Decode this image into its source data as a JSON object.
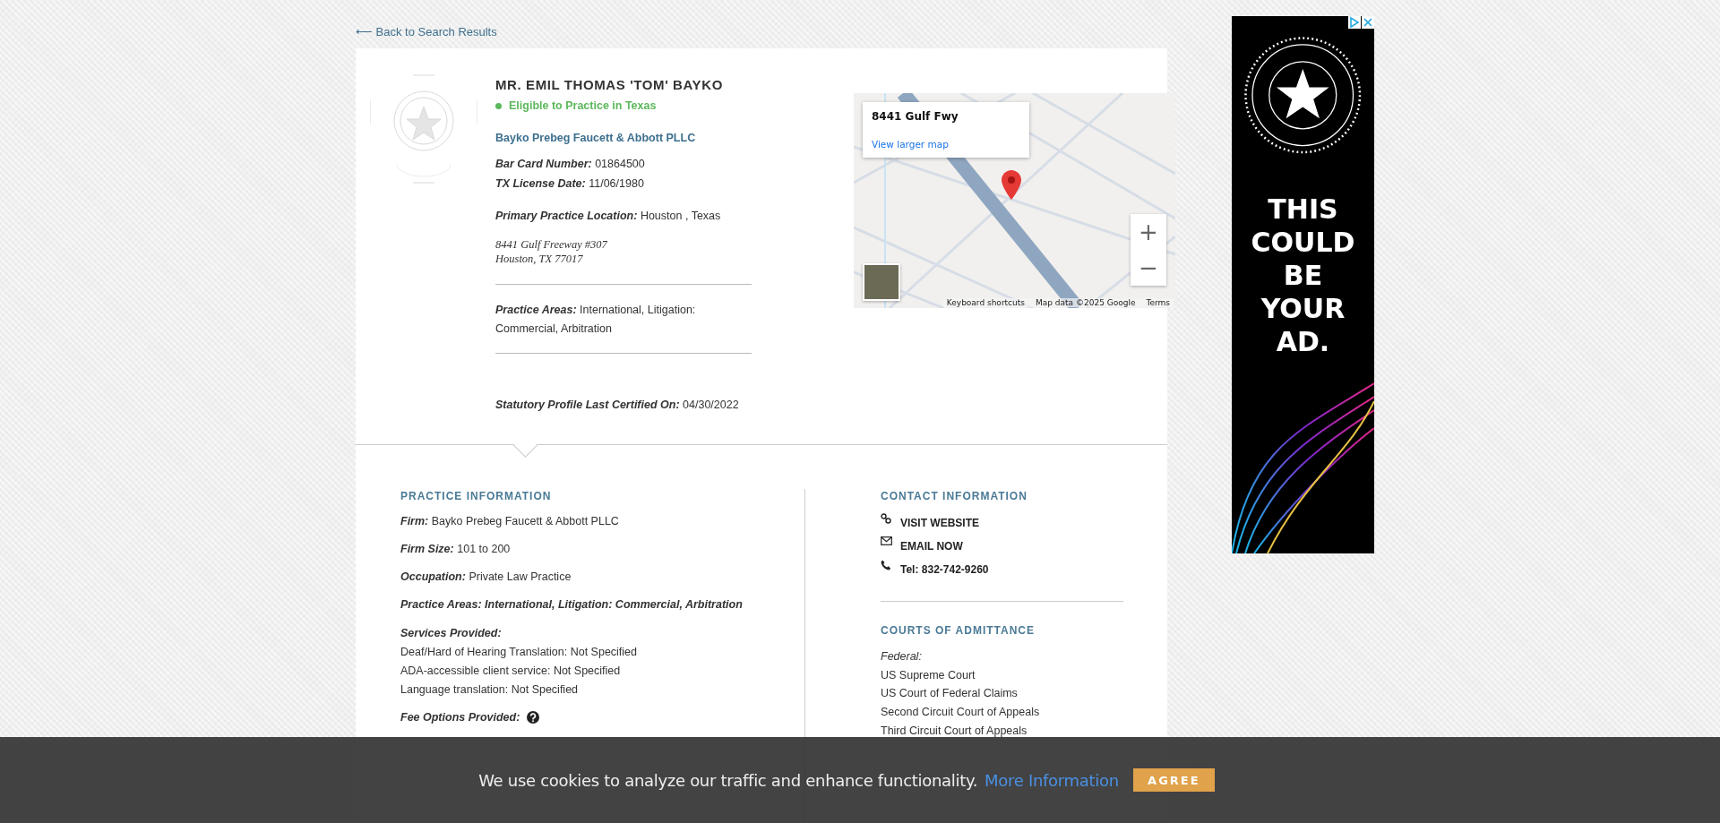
{
  "back_link": "⟵ Back to Search Results",
  "profile": {
    "name": "MR. EMIL THOMAS 'TOM' BAYKO",
    "status": {
      "label": "Eligible to Practice in Texas",
      "eligible": true
    },
    "firm": "Bayko Prebeg Faucett & Abbott PLLC",
    "fields": [
      {
        "label": "Bar Card Number:",
        "value": "01864500"
      },
      {
        "label": "TX License Date:",
        "value": "11/06/1980"
      }
    ],
    "location": {
      "label": "Primary Practice Location:",
      "value": "Houston , Texas"
    },
    "address": [
      "8441 Gulf Freeway #307",
      "Houston, TX 77017"
    ],
    "practice_areas": {
      "label": "Practice Areas:",
      "value": "International, Litigation: Commercial, Arbitration"
    },
    "certified": {
      "label": "Statutory Profile Last Certified On:",
      "value": "04/30/2022"
    }
  },
  "map": {
    "place": "8441 Gulf Fwy",
    "link": "View larger map",
    "zoom_in": "+",
    "zoom_out": "−",
    "footer": [
      "Keyboard shortcuts",
      "Map data ©2025 Google",
      "Terms"
    ]
  },
  "practice_information": {
    "heading": "PRACTICE INFORMATION",
    "items": [
      {
        "label": "Firm:",
        "value": "Bayko Prebeg Faucett & Abbott PLLC"
      },
      {
        "label": "Firm Size:",
        "value": "101 to 200"
      },
      {
        "label": "Occupation:",
        "value": "Private Law Practice"
      }
    ],
    "practice_areas": "Practice Areas: International, Litigation: Commercial, Arbitration",
    "services": {
      "label": "Services Provided:",
      "lines": [
        "Deaf/Hard of Hearing Translation: Not Specified",
        "ADA-accessible client service: Not Specified",
        "Language translation: Not Specified"
      ]
    },
    "fees": {
      "label": "Fee Options Provided:"
    }
  },
  "contact_information": {
    "heading": "CONTACT INFORMATION",
    "items": [
      {
        "kind": "website",
        "label": "VISIT WEBSITE"
      },
      {
        "kind": "email",
        "label": "EMAIL NOW"
      },
      {
        "kind": "phone",
        "label": "Tel: 832-742-9260"
      }
    ]
  },
  "courts": {
    "heading": "COURTS OF ADMITTANCE",
    "groups": [
      {
        "label": "Federal:",
        "courts": [
          "US Supreme Court",
          "US Court of Federal Claims",
          "Second Circuit Court of Appeals",
          "Third Circuit Court of Appeals"
        ]
      }
    ]
  },
  "ad": {
    "headline": "THIS COULD BE YOUR AD."
  },
  "cookie_bar": {
    "message": "We use cookies to analyze our traffic and enhance functionality.",
    "link": "More Information",
    "button": "AGREE"
  }
}
